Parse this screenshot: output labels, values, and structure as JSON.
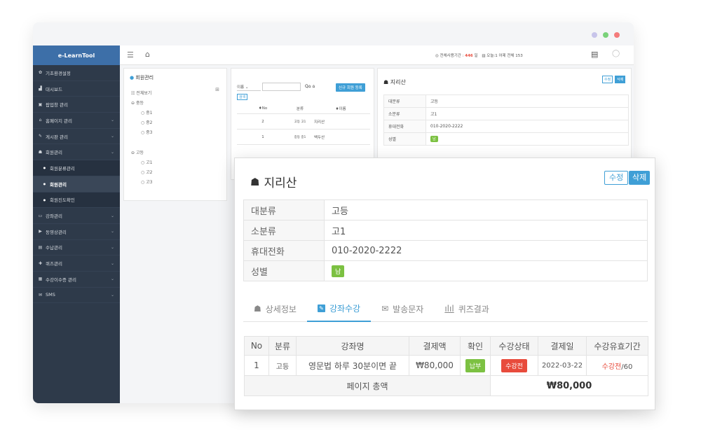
{
  "app": {
    "brand": "e-LearnTool"
  },
  "topbar": {
    "status_prefix": "◎ 전체사용기간 :",
    "status_days": "446",
    "status_suffix": "일",
    "stats_prefix": "오늘:1 어제 전체",
    "stats_count": "153"
  },
  "sidebar": {
    "items": [
      {
        "label": "기초환경설정",
        "icon": "gear-icon",
        "glyph": "✿"
      },
      {
        "label": "대시보드",
        "icon": "dashboard-icon",
        "glyph": "▟"
      },
      {
        "label": "팝업창 관리",
        "icon": "popup-icon",
        "glyph": "▣"
      },
      {
        "label": "홈페이지 관리",
        "icon": "home-icon",
        "glyph": "⌂"
      },
      {
        "label": "게시판 관리",
        "icon": "pencil-icon",
        "glyph": "✎"
      },
      {
        "label": "회원관리",
        "icon": "users-icon",
        "glyph": "☗"
      },
      {
        "label": "회원분류관리",
        "icon": "bullet-icon",
        "glyph": "●"
      },
      {
        "label": "회원관리",
        "icon": "bullet-icon",
        "glyph": "●"
      },
      {
        "label": "회원진도확인",
        "icon": "bullet-icon",
        "glyph": "●"
      },
      {
        "label": "강좌관리",
        "icon": "folder-icon",
        "glyph": "▭"
      },
      {
        "label": "동영상관리",
        "icon": "video-icon",
        "glyph": "▶"
      },
      {
        "label": "수납관리",
        "icon": "card-icon",
        "glyph": "▤"
      },
      {
        "label": "퀴즈관리",
        "icon": "quiz-icon",
        "glyph": "✚"
      },
      {
        "label": "수강이수증 관리",
        "icon": "certificate-icon",
        "glyph": "▦"
      },
      {
        "label": "SMS",
        "icon": "mail-icon",
        "glyph": "✉"
      }
    ]
  },
  "tree": {
    "title": "회원관리",
    "nodes": [
      "전체보기",
      "중등",
      "중1",
      "중2",
      "중3",
      "고등",
      "고1",
      "고2",
      "고3"
    ]
  },
  "list": {
    "filter_value": "이름",
    "search_button": "검색",
    "add_button": "신규 회원 등록",
    "headers": [
      "No",
      "분류",
      "이름"
    ],
    "rows": [
      {
        "no": "2",
        "cat": "고등 고1",
        "name": "지리산"
      },
      {
        "no": "1",
        "cat": "중등 중1",
        "name": "백두산"
      }
    ]
  },
  "detail_bg": {
    "name": "지리산",
    "edit": "수정",
    "delete": "삭제",
    "rows": [
      {
        "k": "대분류",
        "v": "고등"
      },
      {
        "k": "소분류",
        "v": "고1"
      },
      {
        "k": "휴대전화",
        "v": "010-2020-2222"
      },
      {
        "k": "성별",
        "v": "남"
      }
    ]
  },
  "modal": {
    "name": "지리산",
    "edit": "수정",
    "delete": "삭제",
    "info": [
      {
        "k": "대분류",
        "v": "고등"
      },
      {
        "k": "소분류",
        "v": "고1"
      },
      {
        "k": "휴대전화",
        "v": "010-2020-2222"
      },
      {
        "k": "성별",
        "v": "남"
      }
    ],
    "tabs": [
      "상세정보",
      "강좌수강",
      "발송문자",
      "퀴즈결과"
    ],
    "course_headers": [
      "No",
      "분류",
      "강좌명",
      "결제액",
      "확인",
      "수강상태",
      "결제일",
      "수강유효기간"
    ],
    "course_row": {
      "no": "1",
      "cat": "고등",
      "title": "영문법 하루 30분이면 끝",
      "amount": "₩80,000",
      "confirm": "납부",
      "status": "수강전",
      "date": "2022-03-22",
      "period_status": "수강전",
      "period_days": "/60"
    },
    "total_label": "페이지 총액",
    "total_value": "₩80,000"
  },
  "colors": {
    "accent": "#3f9fd6",
    "sidebar": "#2e3a4a",
    "brand": "#3d6fa8",
    "green": "#7cc142",
    "red": "#e84b3c"
  }
}
